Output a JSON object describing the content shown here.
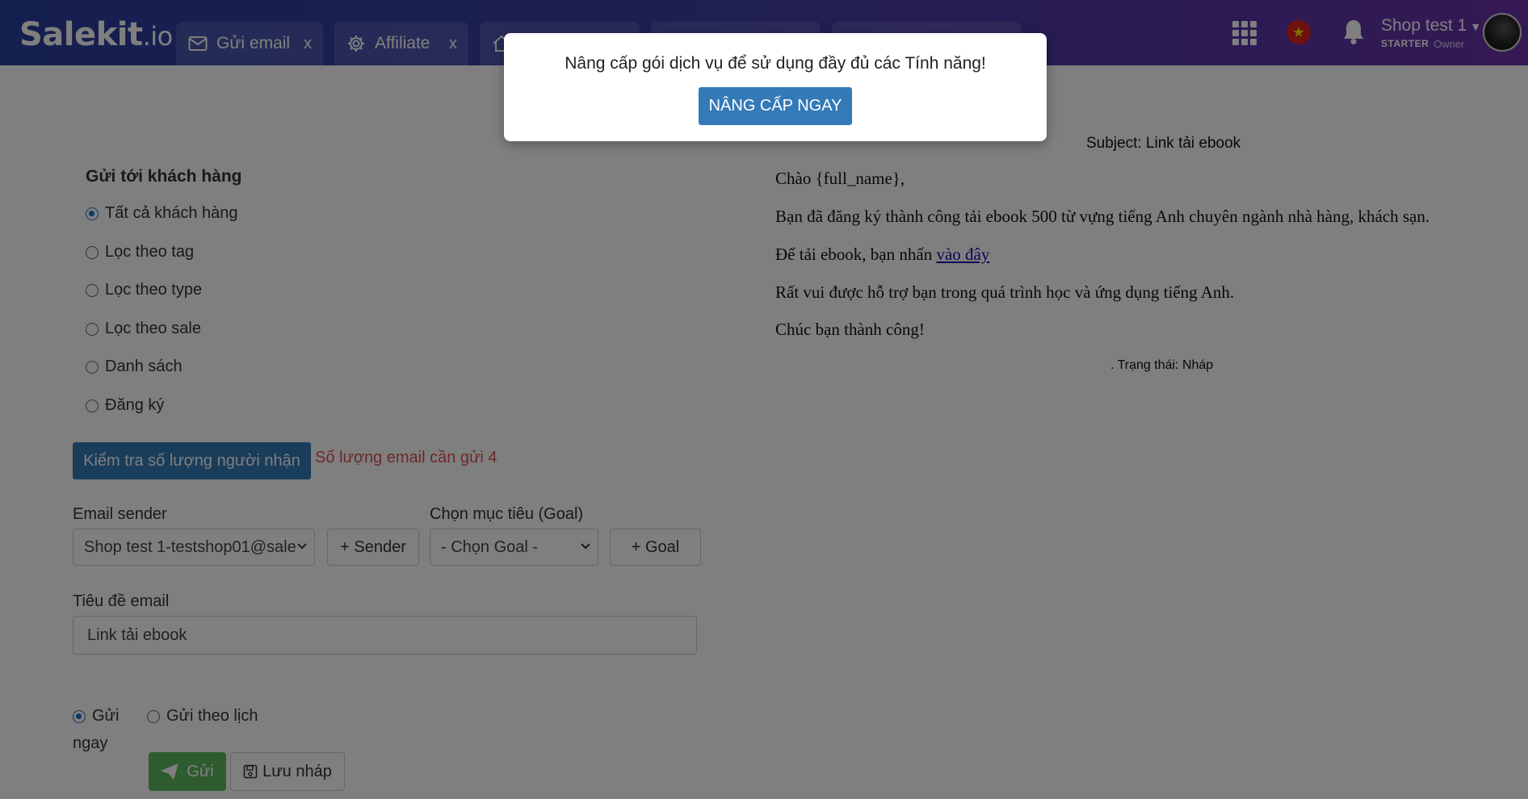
{
  "header": {
    "logo_main": "Salekit",
    "logo_suffix": ".io",
    "tabs": [
      {
        "label": "Gửi email",
        "close": "x"
      },
      {
        "label": "Affiliate",
        "close": "x"
      }
    ],
    "shop_name": "Shop test 1",
    "plan": "STARTER",
    "role": "Owner"
  },
  "form": {
    "section_title": "Gửi tới khách hàng",
    "recipient_options": [
      {
        "label": "Tất cả khách hàng",
        "checked": true
      },
      {
        "label": "Lọc theo tag",
        "checked": false
      },
      {
        "label": "Lọc theo type",
        "checked": false
      },
      {
        "label": "Lọc theo sale",
        "checked": false
      },
      {
        "label": "Danh sách",
        "checked": false
      },
      {
        "label": "Đăng ký",
        "checked": false
      }
    ],
    "check_button": "Kiểm tra số lượng người nhận",
    "count_text": "Số lượng email cần gửi 4",
    "sender_label": "Email sender",
    "sender_value": "Shop test 1-testshop01@sale",
    "add_sender": "+ Sender",
    "goal_label": "Chọn mục tiêu (Goal)",
    "goal_value": "- Chọn Goal -",
    "add_goal": "+ Goal",
    "subject_label": "Tiêu đề email",
    "subject_value": "Link tải ebook",
    "send_now_line1": "Gửi",
    "send_now_line2": "ngay",
    "send_schedule": "Gửi theo lịch",
    "send_button": "Gửi",
    "draft_button": "Lưu nháp"
  },
  "preview": {
    "subject": "Subject: Link tải ebook",
    "greeting": "Chào {full_name},",
    "line1": "Bạn đã đăng ký thành công tải ebook 500 từ vựng tiếng Anh chuyên ngành nhà hàng, khách sạn.",
    "line2_prefix": "Để tải ebook, bạn nhấn ",
    "line2_link": "vào đây",
    "line3": "Rất vui được hỗ trợ bạn trong quá trình học và ứng dụng tiếng Anh.",
    "line4": "Chúc bạn thành công!",
    "status": ". Trạng thái: Nháp"
  },
  "modal": {
    "message": "Nâng cấp gói dịch vụ để sử dụng đầy đủ các Tính năng!",
    "button": "NÂNG CẤP NGAY"
  },
  "colors": {
    "primary": "#337ab7",
    "success": "#5cb85c",
    "danger": "#d9534f",
    "header_start": "#2a3f9e",
    "header_end": "#6a32a8"
  }
}
